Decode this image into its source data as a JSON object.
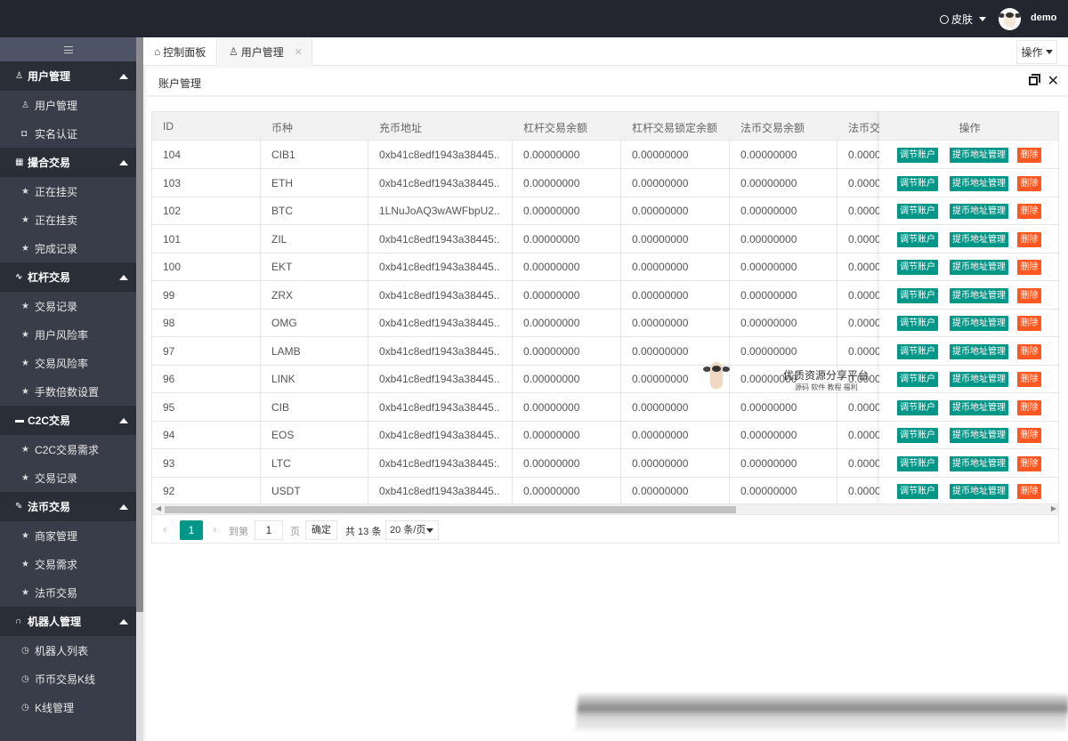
{
  "topbar": {
    "skin_label": "皮肤",
    "username": "demo"
  },
  "sidebar": {
    "groups": [
      {
        "title": "用户管理",
        "icon": "user-icon",
        "items": [
          {
            "label": "用户管理",
            "icon": "user-icon"
          },
          {
            "label": "实名认证",
            "icon": "camera-icon"
          }
        ]
      },
      {
        "title": "撮合交易",
        "icon": "grid-icon",
        "items": [
          {
            "label": "正在挂买",
            "icon": "star-icon"
          },
          {
            "label": "正在挂卖",
            "icon": "star-icon"
          },
          {
            "label": "完成记录",
            "icon": "star-icon"
          }
        ]
      },
      {
        "title": "杠杆交易",
        "icon": "pulse-icon",
        "items": [
          {
            "label": "交易记录",
            "icon": "star-icon"
          },
          {
            "label": "用户风险率",
            "icon": "star-icon"
          },
          {
            "label": "交易风险率",
            "icon": "star-icon"
          },
          {
            "label": "手数倍数设置",
            "icon": "star-icon"
          }
        ]
      },
      {
        "title": "C2C交易",
        "icon": "monitor-icon",
        "items": [
          {
            "label": "C2C交易需求",
            "icon": "star-icon"
          },
          {
            "label": "交易记录",
            "icon": "star-icon"
          }
        ]
      },
      {
        "title": "法币交易",
        "icon": "pen-icon",
        "items": [
          {
            "label": "商家管理",
            "icon": "star-icon"
          },
          {
            "label": "交易需求",
            "icon": "star-icon"
          },
          {
            "label": "法币交易",
            "icon": "star-icon"
          }
        ]
      },
      {
        "title": "机器人管理",
        "icon": "headset-icon",
        "items": [
          {
            "label": "机器人列表",
            "icon": "clock-icon"
          },
          {
            "label": "币币交易K线",
            "icon": "clock-icon"
          },
          {
            "label": "K线管理",
            "icon": "clock-icon"
          }
        ]
      }
    ]
  },
  "tabs": {
    "home": "控制面板",
    "users": "用户管理",
    "operate": "操作"
  },
  "card": {
    "title": "账户管理"
  },
  "table": {
    "headers": [
      "ID",
      "币种",
      "充币地址",
      "杠杆交易余额",
      "杠杆交易锁定余额",
      "法币交易余额",
      "法币交",
      "操作"
    ],
    "actions": {
      "adjust": "调节账户",
      "address": "提币地址管理",
      "delete": "删除"
    },
    "rows": [
      [
        "104",
        "CIB1",
        "0xb41c8edf1943a38445...",
        "0.00000000",
        "0.00000000",
        "0.00000000",
        "0.0000"
      ],
      [
        "103",
        "ETH",
        "0xb41c8edf1943a38445...",
        "0.00000000",
        "0.00000000",
        "0.00000000",
        "0.0000"
      ],
      [
        "102",
        "BTC",
        "1LNuJoAQ3wAWFbpU2...",
        "0.00000000",
        "0.00000000",
        "0.00000000",
        "0.0000"
      ],
      [
        "101",
        "ZIL",
        "0xb41c8edf1943a38445:...",
        "0.00000000",
        "0.00000000",
        "0.00000000",
        "0.0000"
      ],
      [
        "100",
        "EKT",
        "0xb41c8edf1943a38445...",
        "0.00000000",
        "0.00000000",
        "0.00000000",
        "0.0000"
      ],
      [
        "99",
        "ZRX",
        "0xb41c8edf1943a38445...",
        "0.00000000",
        "0.00000000",
        "0.00000000",
        "0.0000"
      ],
      [
        "98",
        "OMG",
        "0xb41c8edf1943a38445...",
        "0.00000000",
        "0.00000000",
        "0.00000000",
        "0.0000"
      ],
      [
        "97",
        "LAMB",
        "0xb41c8edf1943a38445...",
        "0.00000000",
        "0.00000000",
        "0.00000000",
        "0.0000"
      ],
      [
        "96",
        "LINK",
        "0xb41c8edf1943a38445...",
        "0.00000000",
        "0.00000000",
        "0.00000000",
        "0.0000"
      ],
      [
        "95",
        "CIB",
        "0xb41c8edf1943a38445...",
        "0.00000000",
        "0.00000000",
        "0.00000000",
        "0.0000"
      ],
      [
        "94",
        "EOS",
        "0xb41c8edf1943a38445...",
        "0.00000000",
        "0.00000000",
        "0.00000000",
        "0.0000"
      ],
      [
        "93",
        "LTC",
        "0xb41c8edf1943a38445:...",
        "0.00000000",
        "0.00000000",
        "0.00000000",
        "0.0000"
      ],
      [
        "92",
        "USDT",
        "0xb41c8edf1943a38445...",
        "0.00000000",
        "0.00000000",
        "0.00000000",
        "0.0000"
      ]
    ]
  },
  "pager": {
    "current": "1",
    "goto": "到第",
    "page_input": "1",
    "page_unit": "页",
    "confirm": "确定",
    "total": "共 13 条",
    "page_size": "20 条/页"
  },
  "watermark": {
    "title": "优质资源分享平台",
    "subtitle": "源码 软件 教程 福利"
  },
  "colors": {
    "topbar": "#23262e",
    "sidebar": "#393d49",
    "accent": "#009688",
    "danger": "#ff5722"
  }
}
